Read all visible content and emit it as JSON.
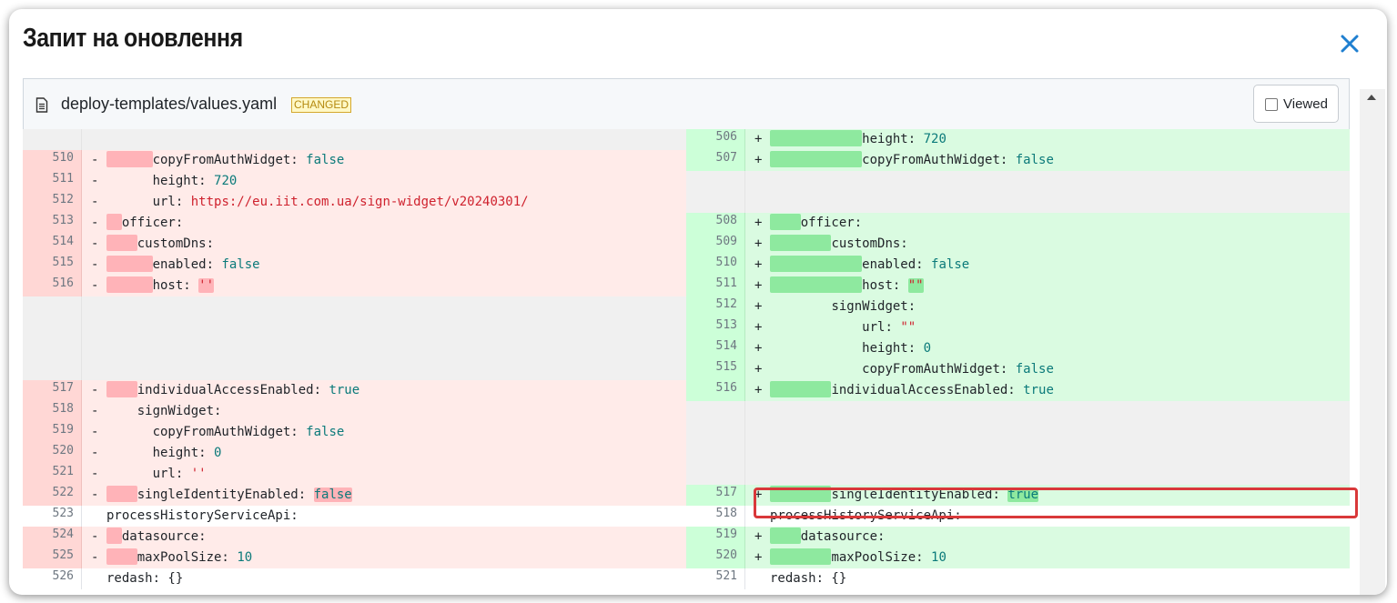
{
  "modal": {
    "title": "Запит на оновлення"
  },
  "file": {
    "name": "deploy-templates/values.yaml",
    "badge": "CHANGED",
    "viewed_label": "Viewed"
  },
  "icons": {
    "close": "close-icon",
    "file": "file-icon",
    "scroll": "chevron-up-icon"
  },
  "colors": {
    "accent": "#1f7fd0",
    "highlight": "#d9383a",
    "deleted": "#ffebe9",
    "added": "#dafbe1"
  },
  "rows": [
    {
      "left": {
        "type": "empty"
      },
      "right": {
        "type": "add",
        "ln": "506",
        "sign": "+",
        "indent": 6,
        "key": "height:",
        "val": "720",
        "vtype": "num"
      }
    },
    {
      "left": {
        "type": "del",
        "ln": "510",
        "sign": "-",
        "indent": 3,
        "key": "copyFromAuthWidget:",
        "val": "false",
        "vtype": "bool"
      },
      "right": {
        "type": "add",
        "ln": "507",
        "sign": "+",
        "indent": 6,
        "key": "copyFromAuthWidget:",
        "val": "false",
        "vtype": "bool"
      }
    },
    {
      "left": {
        "type": "del",
        "ln": "511",
        "sign": "-",
        "indent": 3,
        "plain": true,
        "key": "height:",
        "val": "720",
        "vtype": "num"
      },
      "right": {
        "type": "empty"
      }
    },
    {
      "left": {
        "type": "del",
        "ln": "512",
        "sign": "-",
        "indent": 3,
        "plain": true,
        "key": "url:",
        "val": "https://eu.iit.com.ua/sign-widget/v20240301/",
        "vtype": "str"
      },
      "right": {
        "type": "empty"
      }
    },
    {
      "left": {
        "type": "del",
        "ln": "513",
        "sign": "-",
        "indent": 1,
        "key": "officer:"
      },
      "right": {
        "type": "add",
        "ln": "508",
        "sign": "+",
        "indent": 2,
        "key": "officer:"
      }
    },
    {
      "left": {
        "type": "del",
        "ln": "514",
        "sign": "-",
        "indent": 2,
        "key": "customDns:"
      },
      "right": {
        "type": "add",
        "ln": "509",
        "sign": "+",
        "indent": 4,
        "key": "customDns:"
      }
    },
    {
      "left": {
        "type": "del",
        "ln": "515",
        "sign": "-",
        "indent": 3,
        "key": "enabled:",
        "val": "false",
        "vtype": "bool"
      },
      "right": {
        "type": "add",
        "ln": "510",
        "sign": "+",
        "indent": 6,
        "key": "enabled:",
        "val": "false",
        "vtype": "bool"
      }
    },
    {
      "left": {
        "type": "del",
        "ln": "516",
        "sign": "-",
        "indent": 3,
        "key": "host:",
        "val": "''",
        "vtype": "str",
        "valhl": true
      },
      "right": {
        "type": "add",
        "ln": "511",
        "sign": "+",
        "indent": 6,
        "key": "host:",
        "val": "\"\"",
        "vtype": "str",
        "valhl": true
      }
    },
    {
      "left": {
        "type": "empty"
      },
      "right": {
        "type": "add",
        "ln": "512",
        "sign": "+",
        "indent": 4,
        "plain": true,
        "key": "signWidget:"
      }
    },
    {
      "left": {
        "type": "empty"
      },
      "right": {
        "type": "add",
        "ln": "513",
        "sign": "+",
        "indent": 6,
        "plain": true,
        "key": "url:",
        "val": "\"\"",
        "vtype": "str"
      }
    },
    {
      "left": {
        "type": "empty"
      },
      "right": {
        "type": "add",
        "ln": "514",
        "sign": "+",
        "indent": 6,
        "plain": true,
        "key": "height:",
        "val": "0",
        "vtype": "num"
      }
    },
    {
      "left": {
        "type": "empty"
      },
      "right": {
        "type": "add",
        "ln": "515",
        "sign": "+",
        "indent": 6,
        "plain": true,
        "key": "copyFromAuthWidget:",
        "val": "false",
        "vtype": "bool"
      }
    },
    {
      "left": {
        "type": "del",
        "ln": "517",
        "sign": "-",
        "indent": 2,
        "key": "individualAccessEnabled:",
        "val": "true",
        "vtype": "bool"
      },
      "right": {
        "type": "add",
        "ln": "516",
        "sign": "+",
        "indent": 4,
        "key": "individualAccessEnabled:",
        "val": "true",
        "vtype": "bool"
      }
    },
    {
      "left": {
        "type": "del",
        "ln": "518",
        "sign": "-",
        "indent": 2,
        "plain": true,
        "key": "signWidget:"
      },
      "right": {
        "type": "empty"
      }
    },
    {
      "left": {
        "type": "del",
        "ln": "519",
        "sign": "-",
        "indent": 3,
        "plain": true,
        "key": "copyFromAuthWidget:",
        "val": "false",
        "vtype": "bool"
      },
      "right": {
        "type": "empty"
      }
    },
    {
      "left": {
        "type": "del",
        "ln": "520",
        "sign": "-",
        "indent": 3,
        "plain": true,
        "key": "height:",
        "val": "0",
        "vtype": "num"
      },
      "right": {
        "type": "empty"
      }
    },
    {
      "left": {
        "type": "del",
        "ln": "521",
        "sign": "-",
        "indent": 3,
        "plain": true,
        "key": "url:",
        "val": "''",
        "vtype": "str"
      },
      "right": {
        "type": "empty"
      }
    },
    {
      "left": {
        "type": "del",
        "ln": "522",
        "sign": "-",
        "indent": 2,
        "key": "singleIdentityEnabled:",
        "val": "false",
        "vtype": "bool",
        "valhl": true
      },
      "right": {
        "type": "add",
        "ln": "517",
        "sign": "+",
        "indent": 4,
        "key": "singleIdentityEnabled:",
        "val": "true",
        "vtype": "bool",
        "valhl": true
      }
    },
    {
      "left": {
        "type": "ctx",
        "ln": "523",
        "sign": "",
        "indent": 0,
        "key": "processHistoryServiceApi:"
      },
      "right": {
        "type": "ctx",
        "ln": "518",
        "sign": "",
        "indent": 0,
        "key": "processHistoryServiceApi:"
      }
    },
    {
      "left": {
        "type": "del",
        "ln": "524",
        "sign": "-",
        "indent": 1,
        "key": "datasource:"
      },
      "right": {
        "type": "add",
        "ln": "519",
        "sign": "+",
        "indent": 2,
        "key": "datasource:"
      }
    },
    {
      "left": {
        "type": "del",
        "ln": "525",
        "sign": "-",
        "indent": 2,
        "key": "maxPoolSize:",
        "val": "10",
        "vtype": "num"
      },
      "right": {
        "type": "add",
        "ln": "520",
        "sign": "+",
        "indent": 4,
        "key": "maxPoolSize:",
        "val": "10",
        "vtype": "num"
      }
    },
    {
      "left": {
        "type": "ctx",
        "ln": "526",
        "sign": "",
        "indent": 0,
        "key": "redash: {}"
      },
      "right": {
        "type": "ctx",
        "ln": "521",
        "sign": "",
        "indent": 0,
        "key": "redash: {}"
      }
    }
  ]
}
